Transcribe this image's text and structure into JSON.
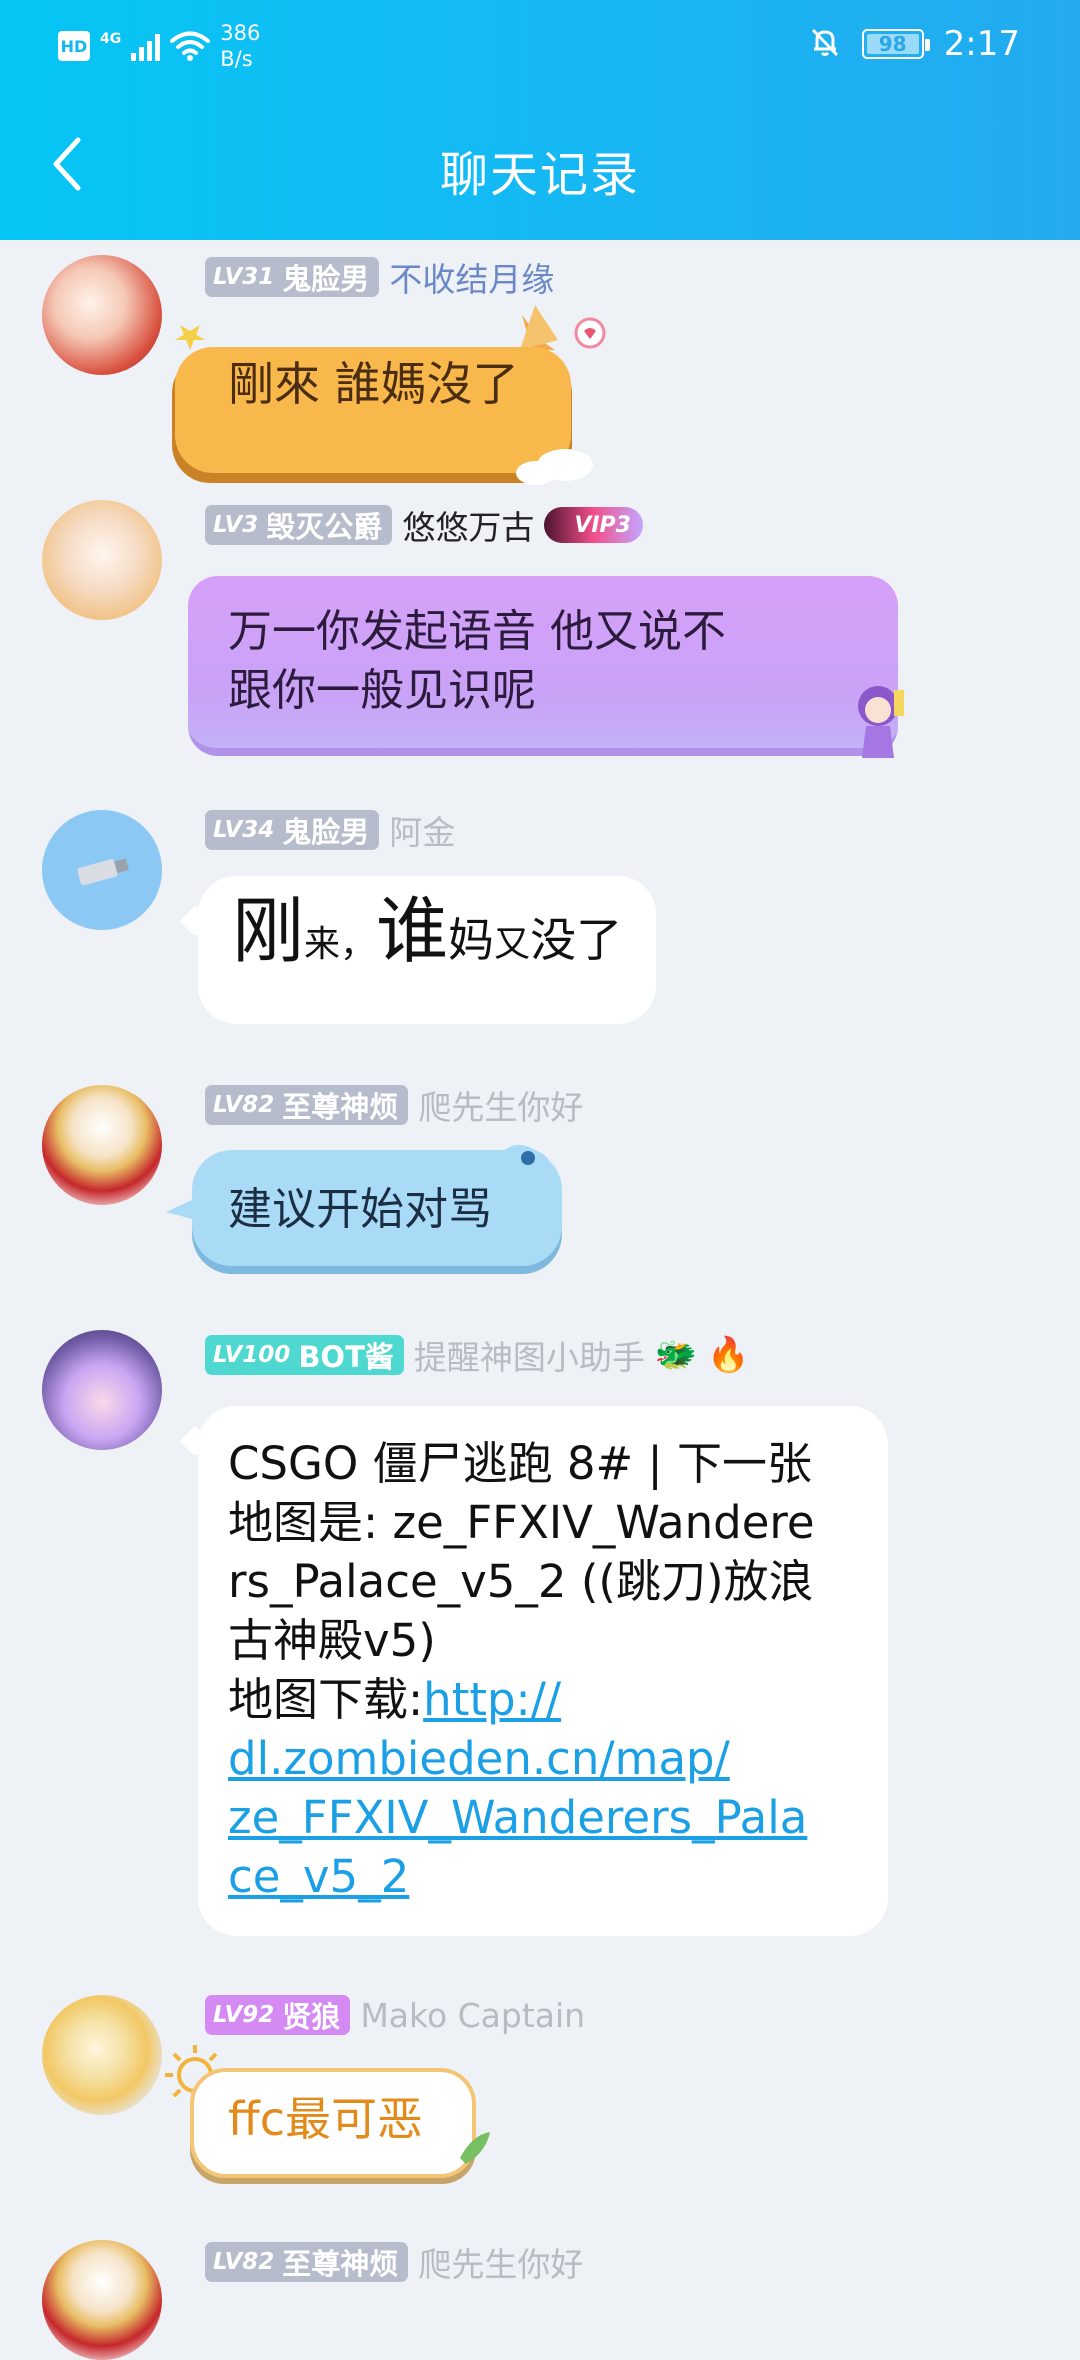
{
  "status_bar": {
    "hd": "HD",
    "network": "4G",
    "speed_value": "386",
    "speed_unit": "B/s",
    "battery": "98",
    "time": "2:17"
  },
  "header": {
    "title": "聊天记录"
  },
  "messages": [
    {
      "level": "LV31",
      "title": "鬼脸男",
      "nickname": "不收结月缘",
      "text": "剛來 誰媽沒了"
    },
    {
      "level": "LV3",
      "title": "毁灭公爵",
      "nickname": "悠悠万古",
      "badge": "VIP3",
      "line1": "万一你发起语音 他又说不",
      "line2": "跟你一般见识呢"
    },
    {
      "level": "LV34",
      "title": "鬼脸男",
      "nickname": "阿金",
      "text_big1": "刚",
      "text_small1": "来，",
      "text_big2": "谁",
      "text_small2": "妈",
      "text_small3": "又",
      "text_small4": "没了"
    },
    {
      "level": "LV82",
      "title": "至尊神烦",
      "nickname": "爬先生你好",
      "text": "建议开始对骂"
    },
    {
      "level": "LV100",
      "title": "BOT酱",
      "nickname": "提醒神图小助手",
      "lines": [
        "CSGO 僵尸逃跑 8# | 下一张",
        "地图是: ze_FFXIV_Wandere",
        "rs_Palace_v5_2 ((跳刀)放浪",
        "古神殿v5)"
      ],
      "link_label": "地图下载:",
      "link_lines": [
        "http://",
        "dl.zombieden.cn/map/",
        "ze_FFXIV_Wanderers_Pala",
        "ce_v5_2"
      ]
    },
    {
      "level": "LV92",
      "title": "贤狼",
      "nickname": "Mako Captain",
      "text": "ffc最可恶"
    },
    {
      "level": "LV82",
      "title": "至尊神烦",
      "nickname": "爬先生你好"
    }
  ],
  "colors": {
    "header_start": "#05c6f5",
    "header_end": "#24aaf0",
    "link": "#1ba0e6",
    "purple_bubble": "#d79cf7",
    "blue_bubble": "#a9dbf7",
    "orange_bubble": "#f7b84b"
  },
  "icons": [
    "back-icon",
    "wifi-icon",
    "mute-bell-icon",
    "battery-icon"
  ]
}
